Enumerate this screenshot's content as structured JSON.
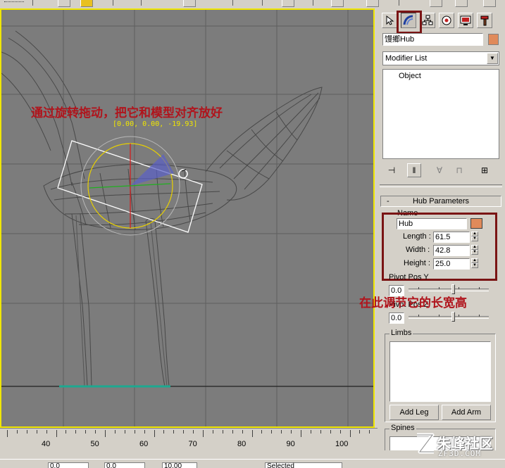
{
  "annotations": {
    "rotate_instruction": "通过旋转拖动，把它和模型对齐放好",
    "size_instruction": "在此调节它的长宽高"
  },
  "viewport": {
    "coord_readout": "[0.00, 0.00, -19.93]",
    "frame_color": "#f0e600",
    "background_color": "#7c7c7c"
  },
  "panel": {
    "tabs": [
      {
        "name": "create",
        "icon": "cursor-arrow-icon"
      },
      {
        "name": "motion",
        "icon": "motion-arc-icon",
        "active": true
      },
      {
        "name": "hierarchy",
        "icon": "hierarchy-icon"
      },
      {
        "name": "display",
        "icon": "display-icon"
      },
      {
        "name": "utilities-monitor",
        "icon": "monitor-icon"
      },
      {
        "name": "utilities",
        "icon": "hammer-icon"
      }
    ],
    "object_name": "馒鄉Hub",
    "object_color": "#e08a5a",
    "modifier_list": "Modifier List",
    "stack_item": "Object"
  },
  "hub_parameters": {
    "title": "Hub Parameters",
    "collapse_symbol": "-",
    "name_label": "Name",
    "name_value": "Hub",
    "name_color": "#e08a5a",
    "length_label": "Length :",
    "length_value": "61.5",
    "width_label": "Width :",
    "width_value": "42.8",
    "height_label": "Height :",
    "height_value": "25.0",
    "pivot_y_label": "Pivot Pos Y",
    "pivot_y_value": "0.0",
    "pivot_z_label": "Pivot Pos Z",
    "pivot_z_value": "0.0",
    "limbs_label": "Limbs",
    "add_leg": "Add Leg",
    "add_arm": "Add Arm",
    "spines_label": "Spines"
  },
  "timeline": {
    "ticks": [
      "40",
      "50",
      "60",
      "70",
      "80",
      "90",
      "100"
    ]
  },
  "statusbar": {
    "field1": "0.0",
    "field2": "0.0",
    "field3": "10.00",
    "selection_mode": "Selected"
  },
  "watermark": {
    "text": "朱峰社区",
    "url": "ZF3D.COM"
  }
}
